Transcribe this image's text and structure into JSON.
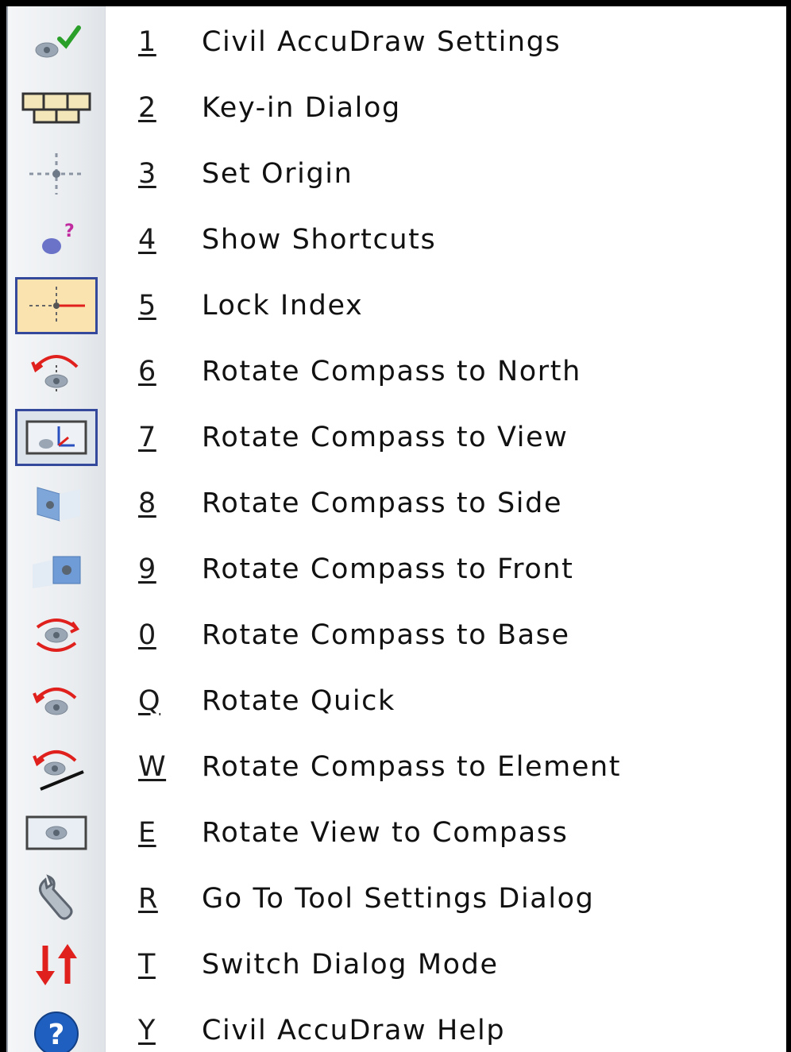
{
  "menu": {
    "items": [
      {
        "key": "1",
        "label": "Civil AccuDraw Settings",
        "icon": "settings-check-icon",
        "checked": false
      },
      {
        "key": "2",
        "label": "Key-in Dialog",
        "icon": "keyboard-icon",
        "checked": false
      },
      {
        "key": "3",
        "label": "Set Origin",
        "icon": "origin-crosshair-icon",
        "checked": false
      },
      {
        "key": "4",
        "label": "Show Shortcuts",
        "icon": "shortcuts-question-icon",
        "checked": false
      },
      {
        "key": "5",
        "label": "Lock Index",
        "icon": "lock-index-icon",
        "checked": true
      },
      {
        "key": "6",
        "label": "Rotate Compass to North",
        "icon": "rotate-north-icon",
        "checked": false
      },
      {
        "key": "7",
        "label": "Rotate Compass to View",
        "icon": "rotate-view-icon",
        "checked": true
      },
      {
        "key": "8",
        "label": "Rotate Compass to Side",
        "icon": "rotate-side-icon",
        "checked": false
      },
      {
        "key": "9",
        "label": "Rotate Compass to Front",
        "icon": "rotate-front-icon",
        "checked": false
      },
      {
        "key": "0",
        "label": "Rotate Compass to Base",
        "icon": "rotate-base-icon",
        "checked": false
      },
      {
        "key": "Q",
        "label": "Rotate Quick",
        "icon": "rotate-quick-icon",
        "checked": false
      },
      {
        "key": "W",
        "label": "Rotate Compass to Element",
        "icon": "rotate-element-icon",
        "checked": false
      },
      {
        "key": "E",
        "label": "Rotate View to Compass",
        "icon": "rotate-view-to-compass-icon",
        "checked": false
      },
      {
        "key": "R",
        "label": "Go To Tool Settings Dialog",
        "icon": "tool-settings-wrench-icon",
        "checked": false
      },
      {
        "key": "T",
        "label": "Switch Dialog Mode",
        "icon": "switch-arrows-icon",
        "checked": false
      },
      {
        "key": "Y",
        "label": "Civil AccuDraw Help",
        "icon": "help-icon",
        "checked": false
      }
    ]
  },
  "colors": {
    "checked_bg": "#fbe3b0",
    "checked_border": "#34489c",
    "accent_red": "#e0201c",
    "help_blue": "#1f5fbf"
  }
}
